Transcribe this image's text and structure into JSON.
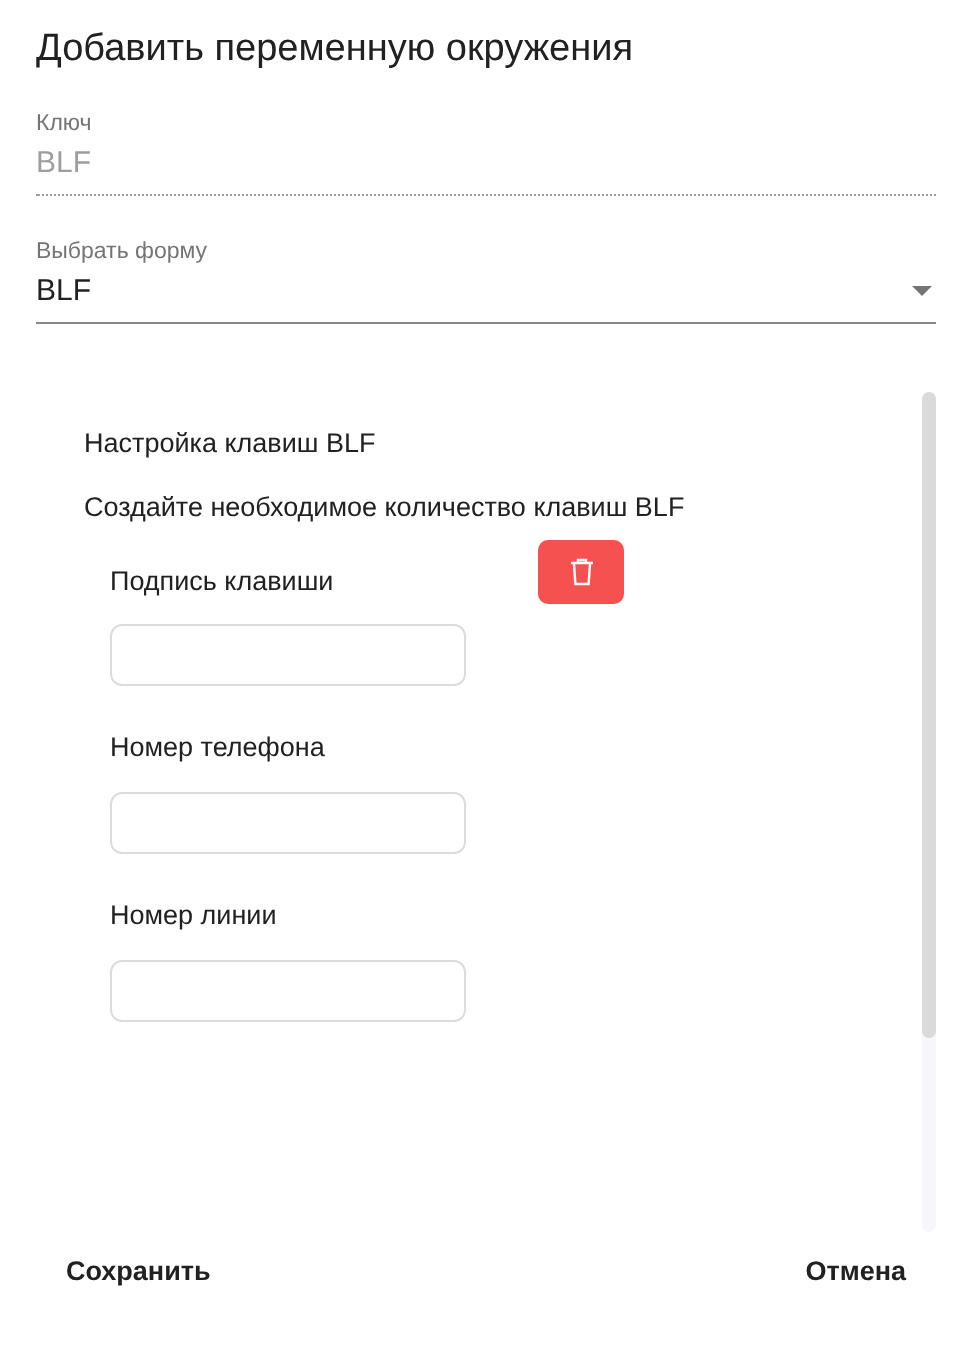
{
  "dialog": {
    "title": "Добавить переменную окружения"
  },
  "key_field": {
    "label": "Ключ",
    "value": "BLF",
    "disabled": true
  },
  "form_select": {
    "label": "Выбрать форму",
    "value": "BLF"
  },
  "panel": {
    "heading": "Настройка клавиш BLF",
    "description": "Создайте необходимое количество клавиш BLF",
    "fields": [
      {
        "label": "Подпись клавиши"
      },
      {
        "label": "Номер телефона"
      },
      {
        "label": "Номер линии"
      }
    ]
  },
  "buttons": [
    {
      "label": "Сохранить"
    },
    {
      "label": "Отмена"
    }
  ]
}
